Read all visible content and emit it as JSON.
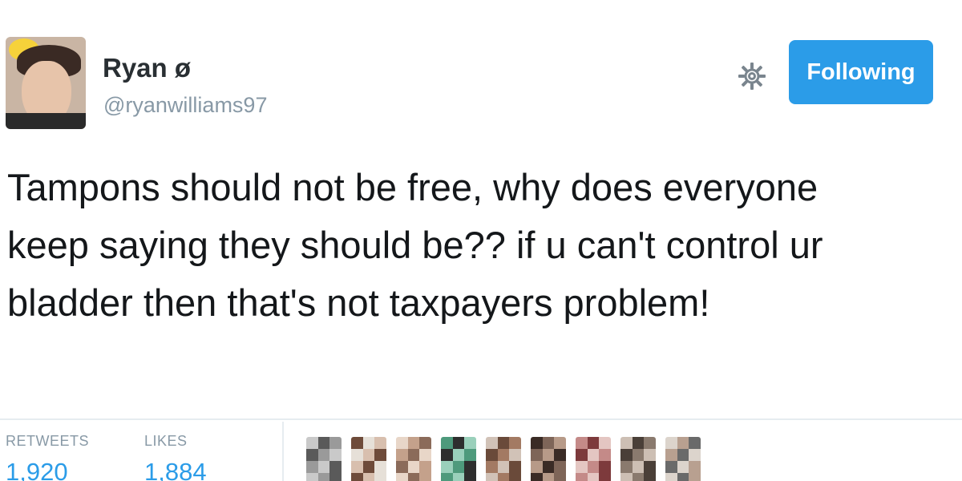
{
  "user": {
    "display_name": "Ryan ø",
    "handle": "@ryanwilliams97"
  },
  "actions": {
    "follow_label": "Following",
    "settings_icon": "gear-icon"
  },
  "tweet": {
    "text": "Tampons should not be free, why does everyone keep saying they should be?? if u can't control ur bladder then that's not taxpayers problem!"
  },
  "stats": {
    "retweets_label": "RETWEETS",
    "retweets_value": "1,920",
    "likes_label": "LIKES",
    "likes_value": "1,884"
  },
  "colors": {
    "accent": "#2b9ce8",
    "text": "#14171a",
    "muted": "#8899a6",
    "divider": "#e6ecf0"
  },
  "likers": [
    {
      "palette": [
        "#c9c9c9",
        "#5a5a5a",
        "#9a9a9a"
      ]
    },
    {
      "palette": [
        "#d8bfae",
        "#6e4b3a",
        "#e6e0d8"
      ]
    },
    {
      "palette": [
        "#c4a18b",
        "#8b6b5a",
        "#e8d6c8"
      ]
    },
    {
      "palette": [
        "#4e9a7c",
        "#2e2e2e",
        "#9ad0bb"
      ]
    },
    {
      "palette": [
        "#a37a63",
        "#d1c2b7",
        "#6a4a3a"
      ]
    },
    {
      "palette": [
        "#7e6558",
        "#b79a88",
        "#3a2b25"
      ]
    },
    {
      "palette": [
        "#c48a88",
        "#7d3a3c",
        "#e4c6c2"
      ]
    },
    {
      "palette": [
        "#8a7a6e",
        "#cdbfb4",
        "#4a3f38"
      ]
    },
    {
      "palette": [
        "#b8a090",
        "#6a6a6a",
        "#dcd4cc"
      ]
    }
  ]
}
